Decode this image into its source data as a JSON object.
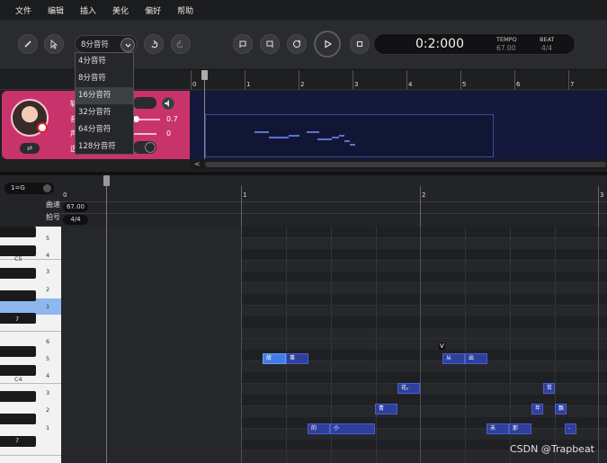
{
  "menu": [
    "文件",
    "编辑",
    "插入",
    "美化",
    "偏好",
    "帮助"
  ],
  "toolbar": {
    "snap_value": "8分音符",
    "time": "0:2:000",
    "tempo_label": "TEMPO",
    "tempo_value": "67.00",
    "beat_label": "BEAT",
    "beat_value": "4/4"
  },
  "snap_options": [
    "4分音符",
    "8分音符",
    "16分音符",
    "32分音符",
    "64分音符",
    "128分音符"
  ],
  "snap_highlighted": "16分音符",
  "track": {
    "labels": [
      "轨",
      "音",
      "声",
      "选"
    ],
    "values": [
      "0.7",
      "0"
    ],
    "ruler": [
      "0",
      "1",
      "2",
      "3",
      "4",
      "5",
      "6",
      "7"
    ],
    "swap_icon": "⇄"
  },
  "roll": {
    "key": "1=G",
    "tempo_label": "曲速",
    "tempo_value": "67.00",
    "beat_label": "拍号",
    "beat_value": "4/4",
    "ruler": [
      "0",
      "1",
      "2",
      "3"
    ]
  },
  "piano_keys": {
    "degrees": [
      "5",
      "4",
      "3",
      "2",
      "1",
      "7",
      "6",
      "5",
      "4",
      "3",
      "2",
      "1",
      "7"
    ],
    "c_labels": [
      "C5",
      "C4"
    ]
  },
  "notes": [
    {
      "text": "故",
      "selected": true
    },
    {
      "text": "事"
    },
    {
      "text": "从"
    },
    {
      "text": "出"
    },
    {
      "text": "花。"
    },
    {
      "text": "贫"
    },
    {
      "text": "青"
    },
    {
      "text": "年"
    },
    {
      "text": "飘"
    },
    {
      "text": "的"
    },
    {
      "text": "小"
    },
    {
      "text": "未"
    },
    {
      "text": "那"
    },
    {
      "text": "-"
    }
  ],
  "vmark": "V",
  "watermark": "CSDN @Trapbeat",
  "colors": {
    "accent": "#c9336c",
    "note": "#2e3f9c",
    "note_selected": "#3f7ce8",
    "key_highlight": "#8fb6ef"
  }
}
